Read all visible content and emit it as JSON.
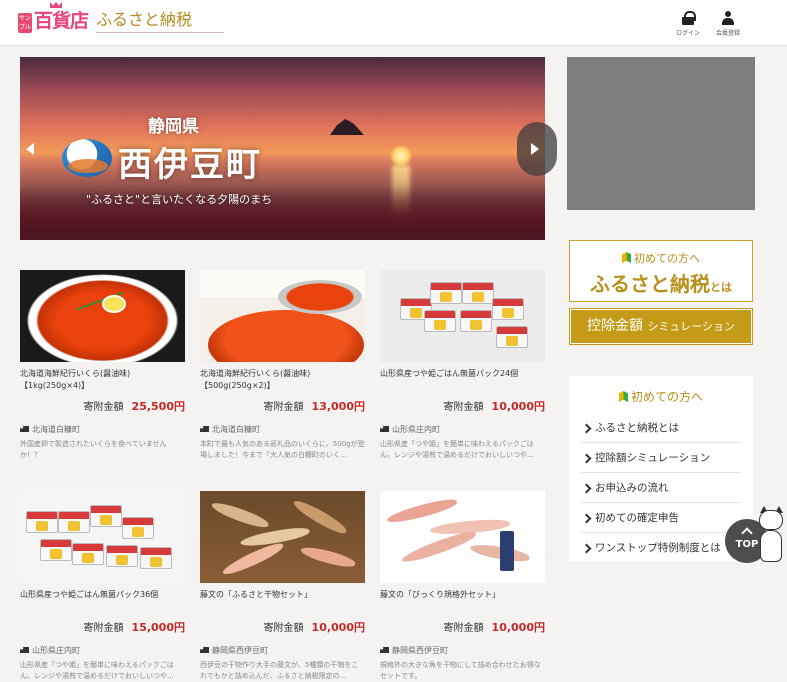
{
  "header": {
    "logo_sample": "サンプル",
    "logo_main": "百貨店",
    "logo_sub": "ふるさと納税",
    "login_label": "ログイン",
    "register_label": "会員登録"
  },
  "banner": {
    "prefecture": "静岡県",
    "town": "西伊豆町",
    "catchphrase": "\"ふるさと\"と言いたくなる夕陽のまち"
  },
  "sidebar": {
    "first_timer_small": "初めての方へ",
    "first_timer_large": "ふるさと納税",
    "first_timer_suffix": "とは",
    "simulation_main": "控除金額",
    "simulation_sub": "シミュレーション",
    "guide_title": "初めての方へ",
    "guide_items": [
      "ふるさと納税とは",
      "控除額シミュレーション",
      "お申込みの流れ",
      "初めての確定申告",
      "ワンストップ特例制度とは"
    ]
  },
  "top_button": "TOP",
  "products": [
    {
      "name": "北海道海鮮紀行いくら(醤油味)【1kg(250g×4)】",
      "price_label": "寄附金額",
      "price": "25,500円",
      "town": "北海道白糠町",
      "desc": "外国産卵で製造されたいくらを食べていませんか！？"
    },
    {
      "name": "北海道海鮮紀行いくら(醤油味)【500g(250g×2)】",
      "price_label": "寄附金額",
      "price": "13,000円",
      "town": "北海道白糠町",
      "desc": "本町で最も人気のある返礼品のいくらに、500gが登場しました！今まで「大人気の白糠町のいく..."
    },
    {
      "name": "山形県産つや姫ごはん無菌パック24個",
      "price_label": "寄附金額",
      "price": "10,000円",
      "town": "山形県庄内町",
      "desc": "山形県産「つや姫」を簡単に味わえるパックごはん。レンジや湯煎で温めるだけでおいしいつや..."
    },
    {
      "name": "山形県産つや姫ごはん無菌パック36個",
      "price_label": "寄附金額",
      "price": "15,000円",
      "town": "山形県庄内町",
      "desc": "山形県産「つや姫」を簡単に味わえるパックごはん。レンジや湯煎で温めるだけでおいしいつや..."
    },
    {
      "name": "藤文の「ふるさと干物セット」",
      "price_label": "寄附金額",
      "price": "10,000円",
      "town": "静岡県西伊豆町",
      "desc": "西伊豆の干物作り大手の藤文が、5種類の干物をこれでもかと詰め込んだ、ふるさと納税限定の..."
    },
    {
      "name": "藤文の「びっくり規格外セット」",
      "price_label": "寄附金額",
      "price": "10,000円",
      "town": "静岡県西伊豆町",
      "desc": "規格外の大きな魚を干物にして詰め合わせたお得なセットです。"
    }
  ]
}
